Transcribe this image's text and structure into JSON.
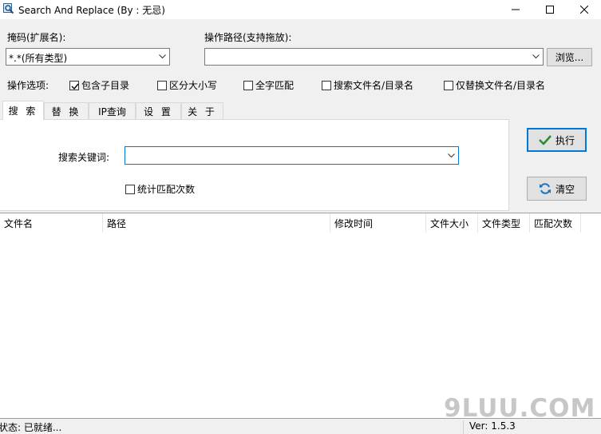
{
  "window": {
    "title": "Search And Replace   (By : 无忌)",
    "icon": "search-replace-app-icon"
  },
  "top": {
    "mask_label": "掩码(扩展名):",
    "mask_value": "*.*(所有类型)",
    "path_label": "操作路径(支持拖放):",
    "path_value": "",
    "browse_label": "浏览..."
  },
  "options": {
    "label": "操作选项:",
    "items": [
      {
        "label": "包含子目录",
        "checked": true
      },
      {
        "label": "区分大小写",
        "checked": false
      },
      {
        "label": "全字匹配",
        "checked": false
      },
      {
        "label": "搜索文件名/目录名",
        "checked": false
      },
      {
        "label": "仅替换文件名/目录名",
        "checked": false
      }
    ]
  },
  "tabs": [
    {
      "label": "搜 索",
      "active": true
    },
    {
      "label": "替 换",
      "active": false
    },
    {
      "label": "IP查询",
      "active": false
    },
    {
      "label": "设 置",
      "active": false
    },
    {
      "label": "关 于",
      "active": false
    }
  ],
  "search": {
    "keyword_label": "搜索关键词:",
    "keyword_value": "",
    "count_label": "统计匹配次数",
    "count_checked": false
  },
  "actions": {
    "execute_label": "执行",
    "clear_label": "清空"
  },
  "table": {
    "columns": [
      "文件名",
      "路径",
      "修改时间",
      "文件大小",
      "文件类型",
      "匹配次数"
    ]
  },
  "status": {
    "text": "状态: 已就绪...",
    "version": "Ver:  1.5.3"
  },
  "watermark": "9LUU.COM",
  "colors": {
    "accent": "#0078d7",
    "check_green": "#2a8a3a",
    "refresh_blue": "#1e73be"
  }
}
